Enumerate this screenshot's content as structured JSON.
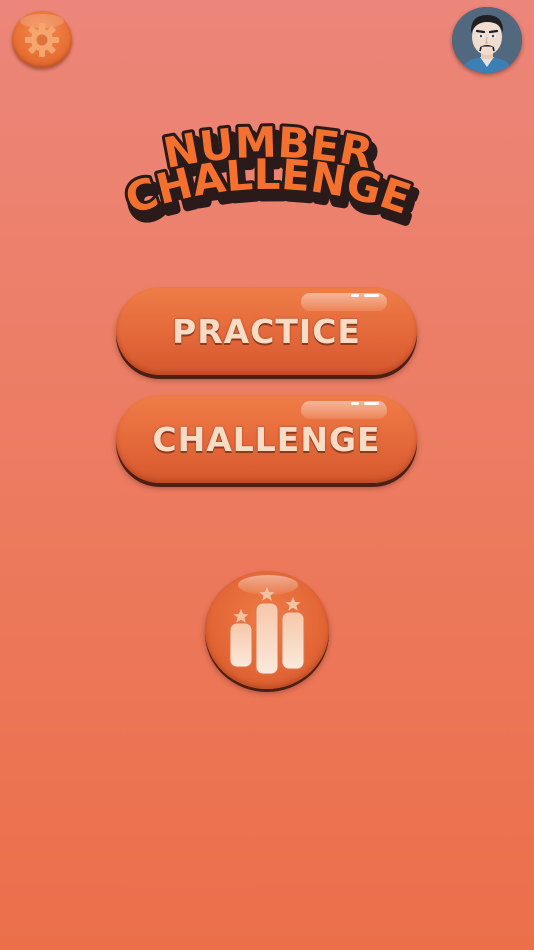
{
  "header": {
    "settings_icon": "gear-icon",
    "avatar_icon": "player-avatar"
  },
  "title": {
    "line1": "NUMBER",
    "line2": "CHALLENGE"
  },
  "menu": {
    "practice_label": "PRACTICE",
    "challenge_label": "CHALLENGE",
    "leaderboard_icon": "leaderboard-icon"
  },
  "colors": {
    "background_top": "#ec867a",
    "background_bottom": "#ec6f4a",
    "button_orange": "#e4683a",
    "button_text": "#f8dcc6",
    "title_fill": "#f26a2e"
  }
}
